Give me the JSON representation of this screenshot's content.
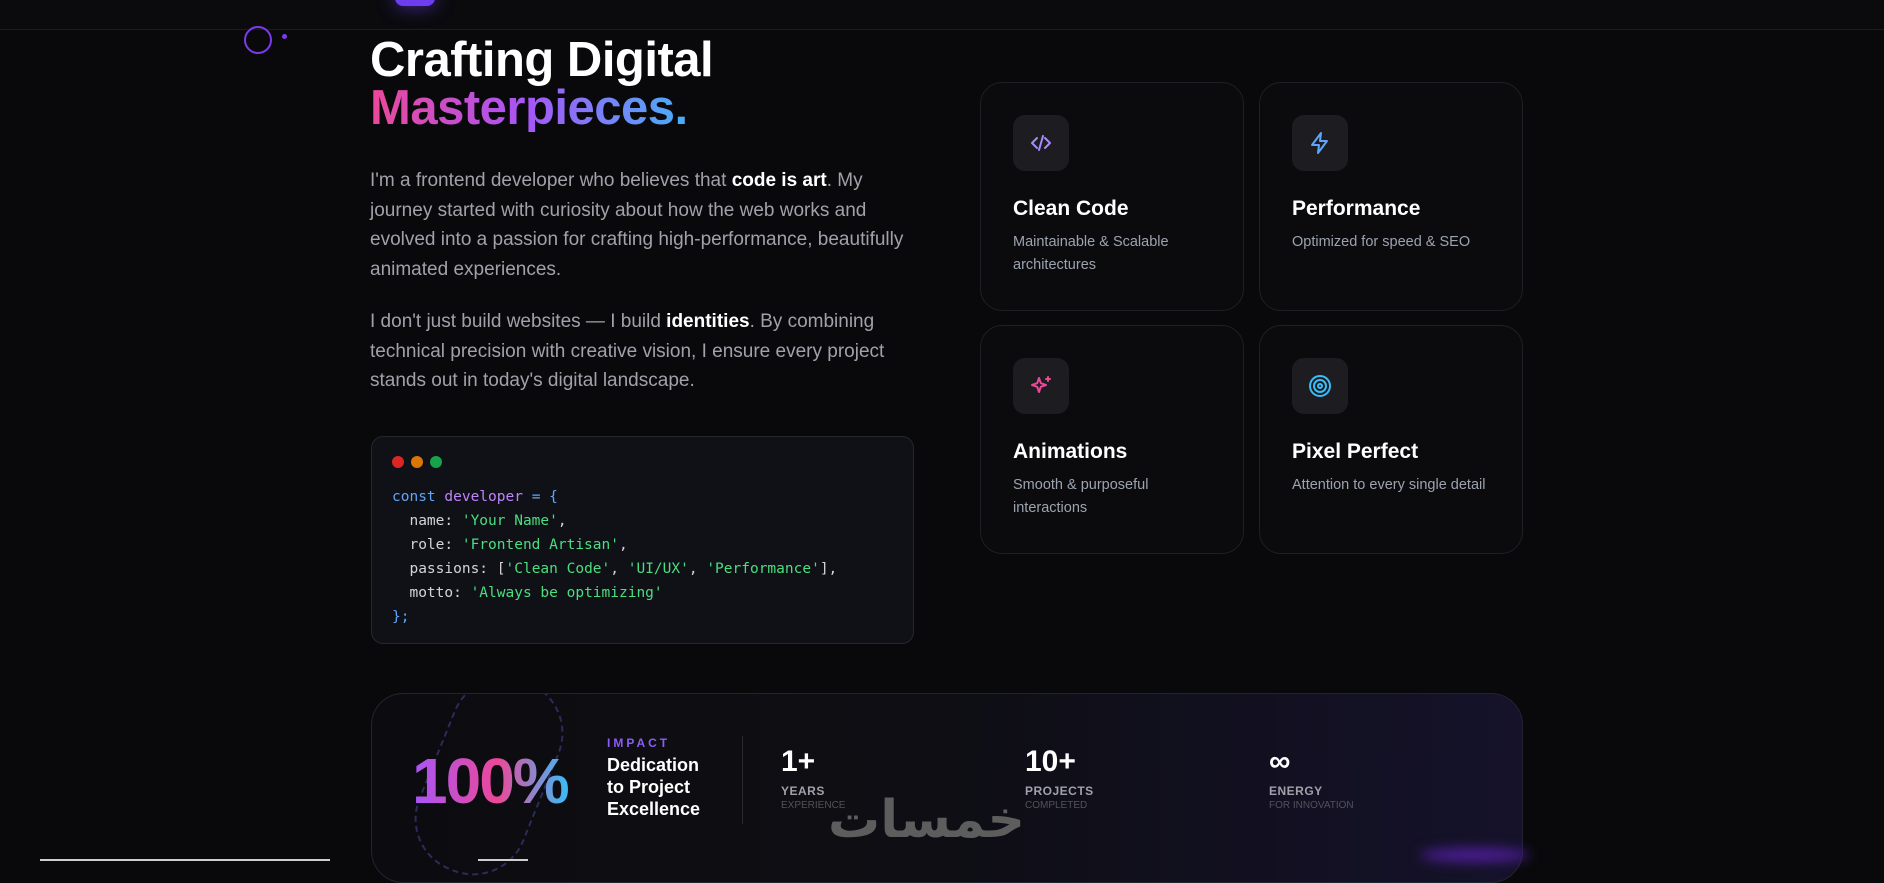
{
  "hero": {
    "title_line1": "Crafting Digital",
    "title_line2": "Masterpieces."
  },
  "about": {
    "p1_before": "I'm a frontend developer who believes that ",
    "p1_highlight": "code is art",
    "p1_after": ". My journey started with curiosity about how the web works and evolved into a passion for crafting high-performance, beautifully animated experiences.",
    "p2_before": "I don't just build websites — I build ",
    "p2_highlight": "identities",
    "p2_after": ". By combining technical precision with creative vision, I ensure every project stands out in today's digital landscape."
  },
  "code_window": {
    "dot_colors": [
      "#dc2626",
      "#d97706",
      "#16a34a"
    ],
    "line1_kw": "const",
    "line1_var": "developer",
    "line1_rest": "= {",
    "name_key": "  name: ",
    "name_val": "'Your Name'",
    "role_key": "  role: ",
    "role_val": "'Frontend Artisan'",
    "passions_key": "  passions: [",
    "passion1": "'Clean Code'",
    "passion2": "'UI/UX'",
    "passion3": "'Performance'",
    "passions_end": "],",
    "motto_key": "  motto: ",
    "motto_val": "'Always be optimizing'",
    "closing": "};"
  },
  "features": [
    {
      "icon": "code-icon",
      "title": "Clean Code",
      "desc": "Maintainable & Scalable architectures",
      "icon_color": "#a78bfa"
    },
    {
      "icon": "bolt-icon",
      "title": "Performance",
      "desc": "Optimized for speed & SEO",
      "icon_color": "#60a5fa"
    },
    {
      "icon": "sparkles-icon",
      "title": "Animations",
      "desc": "Smooth & purposeful interactions",
      "icon_color": "#ec4899"
    },
    {
      "icon": "target-icon",
      "title": "Pixel Perfect",
      "desc": "Attention to every single detail",
      "icon_color": "#38bdf8"
    }
  ],
  "stats": {
    "big_value": "100%",
    "impact_tag": "IMPACT",
    "impact_title": "Dedication to Project Excellence",
    "items": [
      {
        "value": "1+",
        "label": "YEARS",
        "sub": "EXPERIENCE"
      },
      {
        "value": "10+",
        "label": "PROJECTS",
        "sub": "COMPLETED"
      },
      {
        "value": "∞",
        "label": "ENERGY",
        "sub": "FOR INNOVATION"
      }
    ]
  },
  "watermark": "خمسات"
}
